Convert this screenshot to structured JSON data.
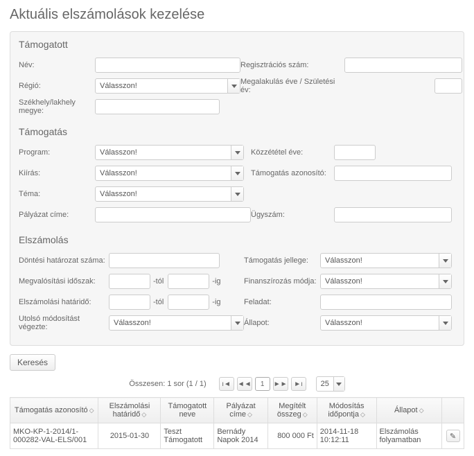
{
  "page_title": "Aktuális elszámolások kezelése",
  "select_placeholder": "Válasszon!",
  "supported": {
    "title": "Támogatott",
    "name_label": "Név:",
    "reg_label": "Regisztrációs szám:",
    "region_label": "Régió:",
    "founding_label": "Megalakulás éve / Születési év:",
    "seat_label": "Székhely/lakhely megye:"
  },
  "support": {
    "title": "Támogatás",
    "program_label": "Program:",
    "pubyear_label": "Közzététel éve:",
    "call_label": "Kiírás:",
    "supportid_label": "Támogatás azonosító:",
    "topic_label": "Téma:",
    "apptitle_label": "Pályázat címe:",
    "caseno_label": "Ügyszám:"
  },
  "settlement": {
    "title": "Elszámolás",
    "decision_label": "Döntési határozat száma:",
    "nature_label": "Támogatás jellege:",
    "period_label": "Megvalósítási időszak:",
    "finance_label": "Finanszírozás módja:",
    "deadline_label": "Elszámolási határidő:",
    "task_label": "Feladat:",
    "lastmod_label": "Utolsó módosítást végezte:",
    "status_label": "Állapot:",
    "from_suffix": "-tól",
    "to_suffix": "-ig"
  },
  "search_button": "Keresés",
  "pager_total": "Összesen: 1 sor (1 / 1)",
  "pager_page": "1",
  "pager_size": "25",
  "table": {
    "headers": {
      "id": "Támogatás azonosító",
      "deadline": "Elszámolási határidő",
      "name": "Támogatott neve",
      "apptitle": "Pályázat címe",
      "amount": "Megítélt összeg",
      "modtime": "Módosítás időpontja",
      "status": "Állapot"
    },
    "row": {
      "id": "MKO-KP-1-2014/1-000282-VAL-ELS/001",
      "deadline": "2015-01-30",
      "name": "Teszt Támogatott",
      "apptitle": "Bernády Napok 2014",
      "amount": "800 000 Ft",
      "modtime": "2014-11-18 10:12:11",
      "status": "Elszámolás folyamatban"
    }
  }
}
